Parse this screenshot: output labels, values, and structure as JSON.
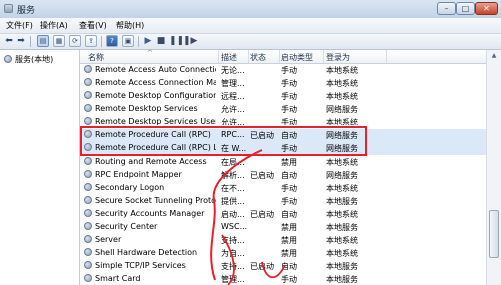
{
  "window": {
    "title": "服务"
  },
  "menu": [
    "文件(F)",
    "操作(A)",
    "查看(V)",
    "帮助(H)"
  ],
  "left_tree": {
    "label": "服务(本地)"
  },
  "columns": {
    "name": "名称",
    "desc": "描述",
    "status": "状态",
    "startup": "启动类型",
    "logon": "登录为"
  },
  "rows": [
    {
      "name": "Remote Access Auto Connection...",
      "desc": "无论...",
      "status": "",
      "startup": "手动",
      "logon": "本地系统"
    },
    {
      "name": "Remote Access Connection Man...",
      "desc": "管理...",
      "status": "",
      "startup": "手动",
      "logon": "本地系统"
    },
    {
      "name": "Remote Desktop Configuration",
      "desc": "远程...",
      "status": "",
      "startup": "手动",
      "logon": "本地系统"
    },
    {
      "name": "Remote Desktop Services",
      "desc": "允许...",
      "status": "",
      "startup": "手动",
      "logon": "网络服务"
    },
    {
      "name": "Remote Desktop Services User...",
      "desc": "允许...",
      "status": "",
      "startup": "手动",
      "logon": "本地系统"
    },
    {
      "name": "Remote Procedure Call (RPC)",
      "desc": "RPC...",
      "status": "已启动",
      "startup": "自动",
      "logon": "网络服务"
    },
    {
      "name": "Remote Procedure Call (RPC) Lo...",
      "desc": "在 W...",
      "status": "",
      "startup": "手动",
      "logon": "网络服务"
    },
    {
      "name": "Routing and Remote Access",
      "desc": "在局...",
      "status": "",
      "startup": "禁用",
      "logon": "本地系统"
    },
    {
      "name": "RPC Endpoint Mapper",
      "desc": "解析...",
      "status": "已启动",
      "startup": "自动",
      "logon": "网络服务"
    },
    {
      "name": "Secondary Logon",
      "desc": "在不...",
      "status": "",
      "startup": "手动",
      "logon": "本地系统"
    },
    {
      "name": "Secure Socket Tunneling Protoc...",
      "desc": "提供...",
      "status": "",
      "startup": "手动",
      "logon": "本地服务"
    },
    {
      "name": "Security Accounts Manager",
      "desc": "启动...",
      "status": "已启动",
      "startup": "自动",
      "logon": "本地系统"
    },
    {
      "name": "Security Center",
      "desc": "WSC...",
      "status": "",
      "startup": "禁用",
      "logon": "本地服务"
    },
    {
      "name": "Server",
      "desc": "支持...",
      "status": "",
      "startup": "禁用",
      "logon": "本地系统"
    },
    {
      "name": "Shell Hardware Detection",
      "desc": "为自...",
      "status": "",
      "startup": "禁用",
      "logon": "本地系统"
    },
    {
      "name": "Simple TCP/IP Services",
      "desc": "支持...",
      "status": "已启动",
      "startup": "自动",
      "logon": "本地服务"
    },
    {
      "name": "Smart Card",
      "desc": "管理...",
      "status": "",
      "startup": "手动",
      "logon": "本地服务"
    }
  ],
  "highlight_color": "#e8202a"
}
